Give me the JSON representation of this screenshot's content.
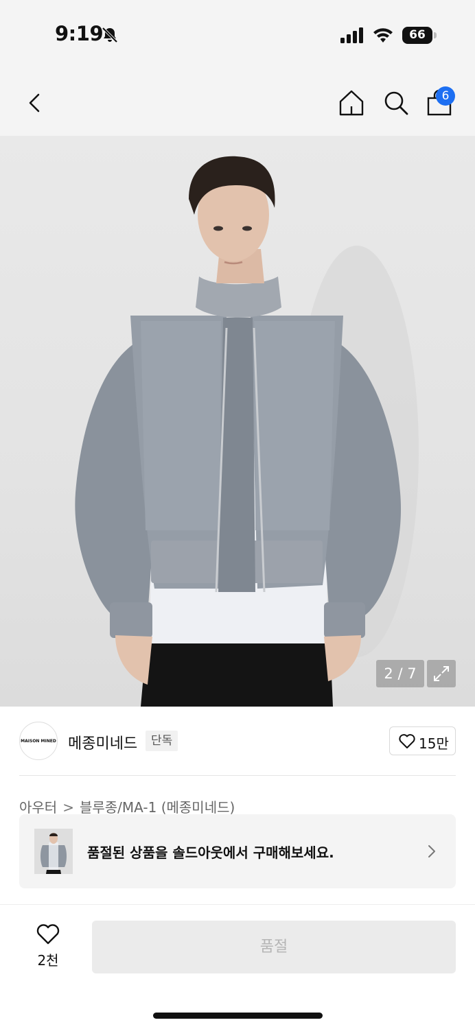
{
  "status_bar": {
    "time": "9:19",
    "battery": "66",
    "icons": [
      "bell-off-icon",
      "cellular-signal-icon",
      "wifi-icon",
      "battery-icon"
    ]
  },
  "nav": {
    "icons": [
      "back-chevron-icon",
      "home-icon",
      "search-icon",
      "shopping-bag-icon"
    ],
    "cart_badge": "6",
    "badge_color": "#1d6ff2"
  },
  "hero": {
    "counter": "2 / 7",
    "expand_icon": "expand-arrows-icon"
  },
  "brand": {
    "logo_text": "MAISON MINED",
    "name": "메종미네드",
    "tag": "단독",
    "likes": "15만"
  },
  "breadcrumb": {
    "category": "아우터",
    "separator": ">",
    "subcategory": "블루종/MA-1 (메종미네드)"
  },
  "soldout_banner": {
    "text": "품절된 상품을 솔드아웃에서 구매해보세요."
  },
  "bottom_bar": {
    "wish_count": "2천",
    "buy_label": "품절"
  }
}
